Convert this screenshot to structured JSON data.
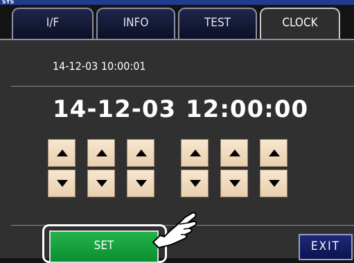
{
  "window": {
    "title": "SYS"
  },
  "tabs": [
    {
      "label": "I/F",
      "active": false
    },
    {
      "label": "INFO",
      "active": false
    },
    {
      "label": "TEST",
      "active": false
    },
    {
      "label": "CLOCK",
      "active": true
    }
  ],
  "clock": {
    "current": "14-12-03  10:00:01",
    "date_setting": "14-12-03",
    "time_setting": "12:00:00"
  },
  "adjust_buttons": {
    "up_icon": "triangle-up-icon",
    "down_icon": "triangle-down-icon",
    "digits": [
      "year",
      "month",
      "day",
      "hour",
      "minute",
      "second"
    ]
  },
  "actions": {
    "set_label": "SET",
    "exit_label": "EXIT"
  },
  "colors": {
    "set_button": "#14a03c",
    "exit_button": "#16206a",
    "adjust_button": "#f2dcc0",
    "title_bar": "#1f3c8f"
  }
}
